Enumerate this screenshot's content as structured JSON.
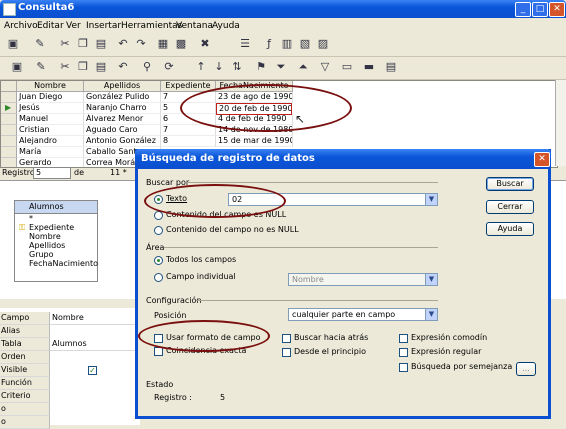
{
  "window": {
    "title": "Consulta6",
    "min": "_",
    "max": "□",
    "close": "✕"
  },
  "menu": [
    "Archivo",
    "Editar",
    "Ver",
    "Insertar",
    "Herramientas",
    "Ventana",
    "Ayuda"
  ],
  "grid": {
    "headers": [
      "Nombre",
      "Apellidos",
      "Expediente",
      "FechaNacimiento"
    ],
    "rows": [
      [
        "Juan Diego",
        "González Pulido",
        "7",
        "23 de ago de 1990"
      ],
      [
        "Jesús",
        "Naranjo Charro",
        "5",
        "20 de feb de 1990"
      ],
      [
        "Manuel",
        "Álvarez Menor",
        "6",
        "4 de feb de 1990"
      ],
      [
        "Cristian",
        "Aguado Caro",
        "7",
        "14 de nov de 1989"
      ],
      [
        "Alejandro",
        "Antonio González",
        "8",
        "15 de mar de 1990"
      ],
      [
        "María",
        "Caballo Santos",
        "",
        ""
      ],
      [
        "Gerardo",
        "Correa Morán",
        "",
        ""
      ]
    ]
  },
  "nav": {
    "label": "Registro",
    "value": "5",
    "of": "de",
    "total": "11 *"
  },
  "table_box": {
    "title": "Alumnos",
    "fields": [
      "*",
      "Expediente",
      "Nombre",
      "Apellidos",
      "Grupo",
      "FechaNacimiento"
    ]
  },
  "props": [
    {
      "label": "Campo",
      "value": "Nombre"
    },
    {
      "label": "Alias",
      "value": ""
    },
    {
      "label": "Tabla",
      "value": "Alumnos"
    },
    {
      "label": "Orden",
      "value": ""
    },
    {
      "label": "Visible",
      "value": ""
    },
    {
      "label": "Función",
      "value": ""
    },
    {
      "label": "Criterio",
      "value": ""
    },
    {
      "label": "o",
      "value": ""
    },
    {
      "label": "o",
      "value": ""
    }
  ],
  "dialog": {
    "title": "Búsqueda de registro de datos",
    "buscar_por": "Buscar por",
    "texto_label": "Texto",
    "texto_value": "02",
    "nulo": "Contenido del campo es NULL",
    "no_nulo": "Contenido del campo no es NULL",
    "area": "Área",
    "todos": "Todos los campos",
    "individual": "Campo individual",
    "individual_value": "Nombre",
    "config": "Configuración",
    "posicion_label": "Posición",
    "posicion_value": "cualquier parte en campo",
    "usar_formato": "Usar formato de campo",
    "coincidencia": "Coincidencia exacta",
    "hacia_atras": "Buscar hacia atrás",
    "desde_principio": "Desde el principio",
    "comodin": "Expresión comodín",
    "regular": "Expresión regular",
    "semejanza": "Búsqueda por semejanza",
    "estado": "Estado",
    "registro_label": "Registro :",
    "registro_value": "5",
    "buttons": {
      "buscar": "Buscar",
      "cerrar": "Cerrar",
      "ayuda": "Ayuda",
      "ellipsis": "..."
    }
  }
}
